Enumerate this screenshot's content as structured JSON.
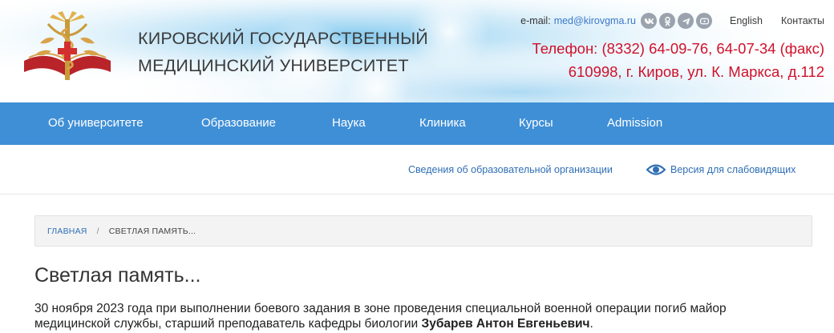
{
  "header": {
    "university_line1": "КИРОВСКИЙ ГОСУДАРСТВЕННЫЙ",
    "university_line2": "МЕДИЦИНСКИЙ УНИВЕРСИТЕТ",
    "email_label": "e-mail:",
    "email": "med@kirovgma.ru",
    "social_icons": [
      "vk-icon",
      "odnoklassniki-icon",
      "telegram-icon",
      "youtube-icon"
    ],
    "lang_link": "English",
    "contacts_link": "Контакты",
    "phone": "Телефон: (8332) 64-09-76, 64-07-34 (факс)",
    "address": "610998, г. Киров, ул. К. Маркса, д.112"
  },
  "nav": {
    "items": [
      "Об университете",
      "Образование",
      "Наука",
      "Клиника",
      "Курсы",
      "Admission"
    ]
  },
  "sublinks": {
    "org_info": "Сведения об образовательной организации",
    "low_vision": "Версия для слабовидящих"
  },
  "breadcrumb": {
    "home": "ГЛАВНАЯ",
    "separator": "/",
    "current": "СВЕТЛАЯ ПАМЯТЬ..."
  },
  "page": {
    "title": "Светлая память...",
    "text_before": "30 ноября 2023 года при выполнении боевого задания в зоне проведения специальной военной операции погиб майор медицинской службы, старший преподаватель кафедры биологии ",
    "text_name": "Зубарев Антон Евгеньевич",
    "text_after": "."
  },
  "colors": {
    "nav_bg": "#3f8fd6",
    "accent_red": "#d0112b",
    "link_blue": "#2f6fb5"
  }
}
